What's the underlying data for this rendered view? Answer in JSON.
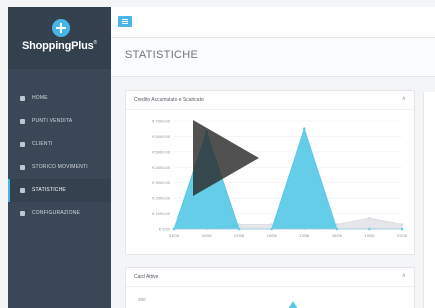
{
  "app": {
    "logo_text": "ShoppingPlus",
    "logo_sup": "®"
  },
  "sidebar": {
    "items": [
      {
        "label": "HOME",
        "icon": "home-icon"
      },
      {
        "label": "PUNTI VENDITA",
        "icon": "store-icon"
      },
      {
        "label": "CLIENTI",
        "icon": "users-icon"
      },
      {
        "label": "STORICO MOVIMENTI",
        "icon": "history-icon"
      },
      {
        "label": "STATISTICHE",
        "icon": "stats-icon",
        "active": true
      },
      {
        "label": "CONFIGURAZIONE",
        "icon": "settings-icon"
      }
    ]
  },
  "header": {
    "page_title": "STATISTICHE"
  },
  "cards": {
    "credito": {
      "title": "Credito Accumulato e Scaricato",
      "caret": "∧"
    },
    "card_attive": {
      "title": "Card Attive",
      "caret": "∧"
    }
  },
  "colors": {
    "sidebar": "#3a4756",
    "accent": "#49b4e7",
    "series_primary": "#54c8e6",
    "series_secondary": "#d8dbdf"
  },
  "chart_data": [
    {
      "type": "area",
      "title": "Credito Accumulato e Scaricato",
      "x": [
        "01/06",
        "04/06",
        "07/06",
        "10/06",
        "13/06",
        "16/06",
        "19/06",
        "22/06"
      ],
      "y_ticks": [
        "€ 0,00",
        "€ 1000,00",
        "€ 2000,00",
        "€ 3000,00",
        "€ 4000,00",
        "€ 5000,00",
        "€ 6000,00",
        "€ 7000,00"
      ],
      "ylim": [
        0,
        7000
      ],
      "series": [
        {
          "color": "#54c8e6",
          "values": [
            0,
            6300,
            0,
            0,
            6500,
            0,
            0,
            0
          ]
        },
        {
          "color": "#d8dbdf",
          "values": [
            0,
            0,
            300,
            300,
            0,
            300,
            700,
            300
          ]
        }
      ]
    },
    {
      "type": "area",
      "title": "Card Attive",
      "y_ticks": [
        "200"
      ],
      "series": [
        {
          "color": "#54c8e6",
          "values": []
        }
      ]
    }
  ]
}
